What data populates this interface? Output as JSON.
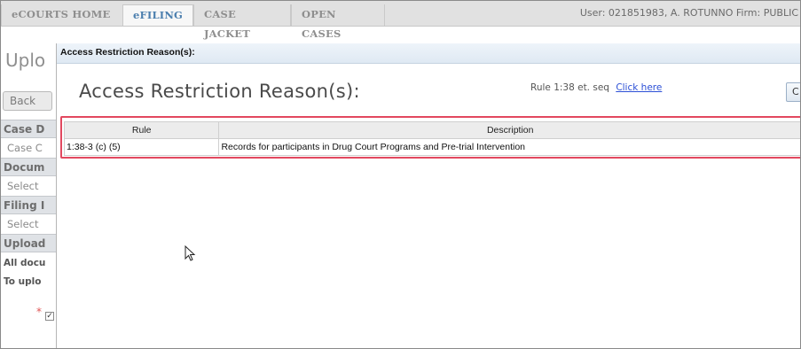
{
  "topnav": {
    "tabs": [
      {
        "label": "eCOURTS HOME",
        "active": false
      },
      {
        "label": "eFILING",
        "active": true
      },
      {
        "label": "CASE JACKET",
        "active": false
      },
      {
        "label": "OPEN CASES",
        "active": false
      }
    ],
    "user_line": "User: 021851983, A. ROTUNNO  Firm: PUBLIC"
  },
  "background_page": {
    "title": "Uplo",
    "back_button": "Back",
    "rows": [
      {
        "type": "head",
        "text": "Case D"
      },
      {
        "type": "sub",
        "text": "Case C"
      },
      {
        "type": "head",
        "text": "Docum"
      },
      {
        "type": "sub",
        "text": "Select"
      },
      {
        "type": "head",
        "text": "Filing I"
      },
      {
        "type": "sub",
        "text": "Select"
      },
      {
        "type": "head",
        "text": "Upload"
      },
      {
        "type": "note",
        "text": "All docu"
      },
      {
        "type": "note",
        "text": "To uplo"
      }
    ],
    "required_star": "*",
    "checkbox_mark": "✓"
  },
  "dialog": {
    "titlebar": "Access Restriction Reason(s):",
    "heading": "Access Restriction Reason(s):",
    "rule_text": "Rule 1:38 et. seq",
    "rule_link": "Click here",
    "close_button": "C",
    "table": {
      "headers": [
        "Rule",
        "Description"
      ],
      "rows": [
        [
          "1:38-3 (c)  (5)",
          "Records for participants in Drug Court Programs and Pre-trial Intervention"
        ]
      ]
    }
  },
  "colors": {
    "highlight_border": "#e2485f",
    "link": "#2b4fd6",
    "active_tab_text": "#4c7fae"
  },
  "icons": [
    "mouse-cursor-icon"
  ]
}
